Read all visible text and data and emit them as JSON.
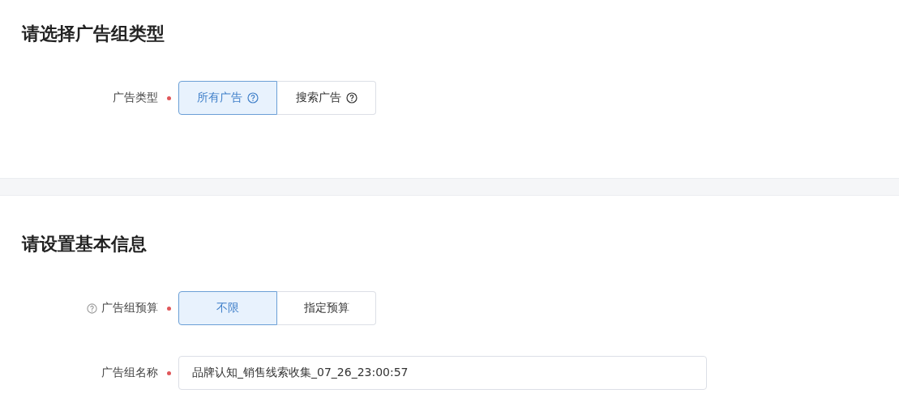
{
  "sections": [
    {
      "title": "请选择广告组类型",
      "fields": [
        {
          "kind": "segmented",
          "label": "广告类型",
          "help": false,
          "required": true,
          "options": [
            {
              "label": "所有广告",
              "help": true,
              "selected": true
            },
            {
              "label": "搜索广告",
              "help": true,
              "selected": false
            }
          ]
        }
      ]
    },
    {
      "title": "请设置基本信息",
      "fields": [
        {
          "kind": "segmented",
          "label": "广告组预算",
          "help": true,
          "required": true,
          "options": [
            {
              "label": "不限",
              "help": false,
              "selected": true
            },
            {
              "label": "指定预算",
              "help": false,
              "selected": false
            }
          ]
        },
        {
          "kind": "text",
          "label": "广告组名称",
          "help": false,
          "required": true,
          "value": "品牌认知_销售线索收集_07_26_23:00:57"
        }
      ]
    }
  ]
}
